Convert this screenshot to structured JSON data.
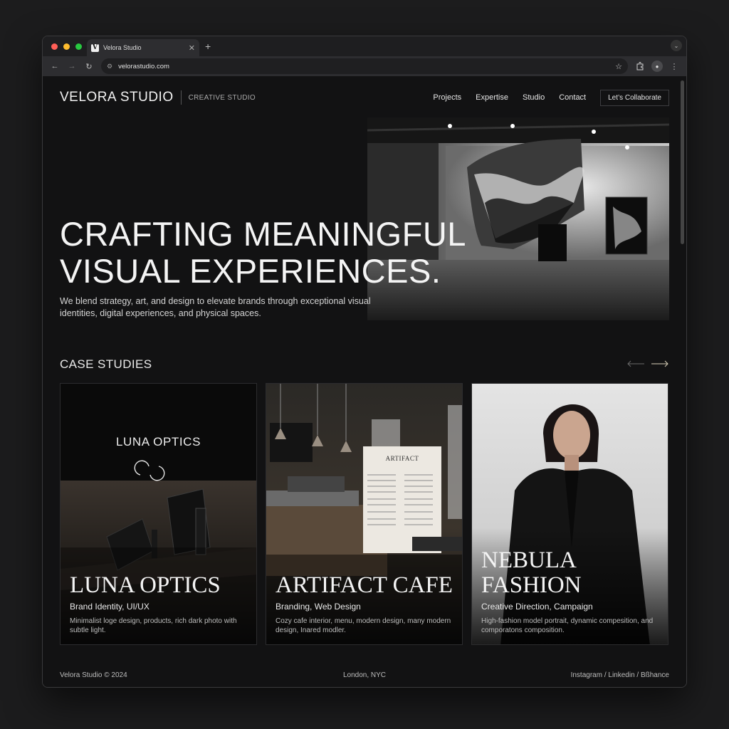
{
  "browser": {
    "tab_title": "Velora Studio",
    "favicon_letter": "V",
    "url": "velorastudio.com"
  },
  "site": {
    "brand": "VELORA STUDIO",
    "tagline": "CREATIVE STUDIO",
    "nav": [
      "Projects",
      "Expertise",
      "Studio",
      "Contact"
    ],
    "cta": "Let’s Collaborate"
  },
  "hero": {
    "title_line1": "CRAFTING MEANINGFUL",
    "title_line2": "VISUAL EXPERIENCES.",
    "copy": "We blend strategy, art, and design to elevate brands through exceptional visual identities, digital experiences, and physical spaces."
  },
  "case_studies": {
    "heading": "CASE STUDIES",
    "cards": [
      {
        "logo_text": "LUNA OPTICS",
        "name_line1": "LUNA OPTICS",
        "name_line2": "",
        "tags": "Brand Identity, UI/UX",
        "desc": "Minimalist loge design, products, rich dark photo with subtle light."
      },
      {
        "menu_title": "ARTIFACT",
        "name_line1": "ARTIFACT CAFE",
        "name_line2": "",
        "tags": "Branding, Web Design",
        "desc": "Cozy cafe interior, menu, modern design, many modern design, Inared modler."
      },
      {
        "name_line1": "NEBULA",
        "name_line2": "FASHION",
        "tags": "Creative Direction, Campaign",
        "desc": "High-fashion model portrait, dynamic compesition, and comporatons composition."
      }
    ]
  },
  "footer": {
    "copyright": "Velora Studio © 2024",
    "location": "London, NYC",
    "social": "Instagram / Linkedin / Bßhance"
  }
}
